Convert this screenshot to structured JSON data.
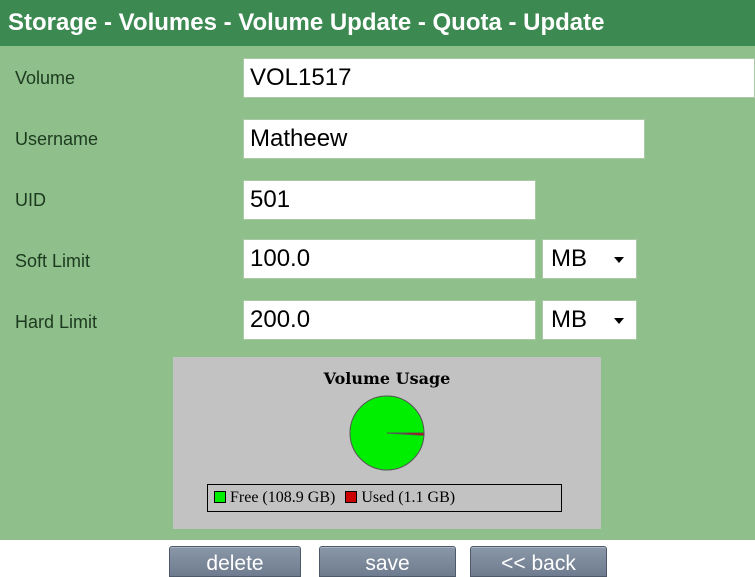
{
  "header": {
    "title": "Storage - Volumes - Volume Update - Quota - Update"
  },
  "form": {
    "volume": {
      "label": "Volume",
      "value": "VOL1517"
    },
    "username": {
      "label": "Username",
      "value": "Matheew"
    },
    "uid": {
      "label": "UID",
      "value": "501"
    },
    "soft_limit": {
      "label": "Soft Limit",
      "value": "100.0",
      "unit": "MB"
    },
    "hard_limit": {
      "label": "Hard Limit",
      "value": "200.0",
      "unit": "MB"
    }
  },
  "usage": {
    "title": "Volume Usage",
    "free_label": "Free (108.9 GB)",
    "used_label": "Used (1.1 GB)",
    "free_value_gb": 108.9,
    "used_value_gb": 1.1,
    "free_color": "#00ee00",
    "used_color": "#cc0000"
  },
  "buttons": {
    "delete": "delete",
    "save": "save",
    "back": "<< back"
  },
  "colors": {
    "titlebar": "#3c8a52",
    "panel": "#8fbf8a"
  }
}
